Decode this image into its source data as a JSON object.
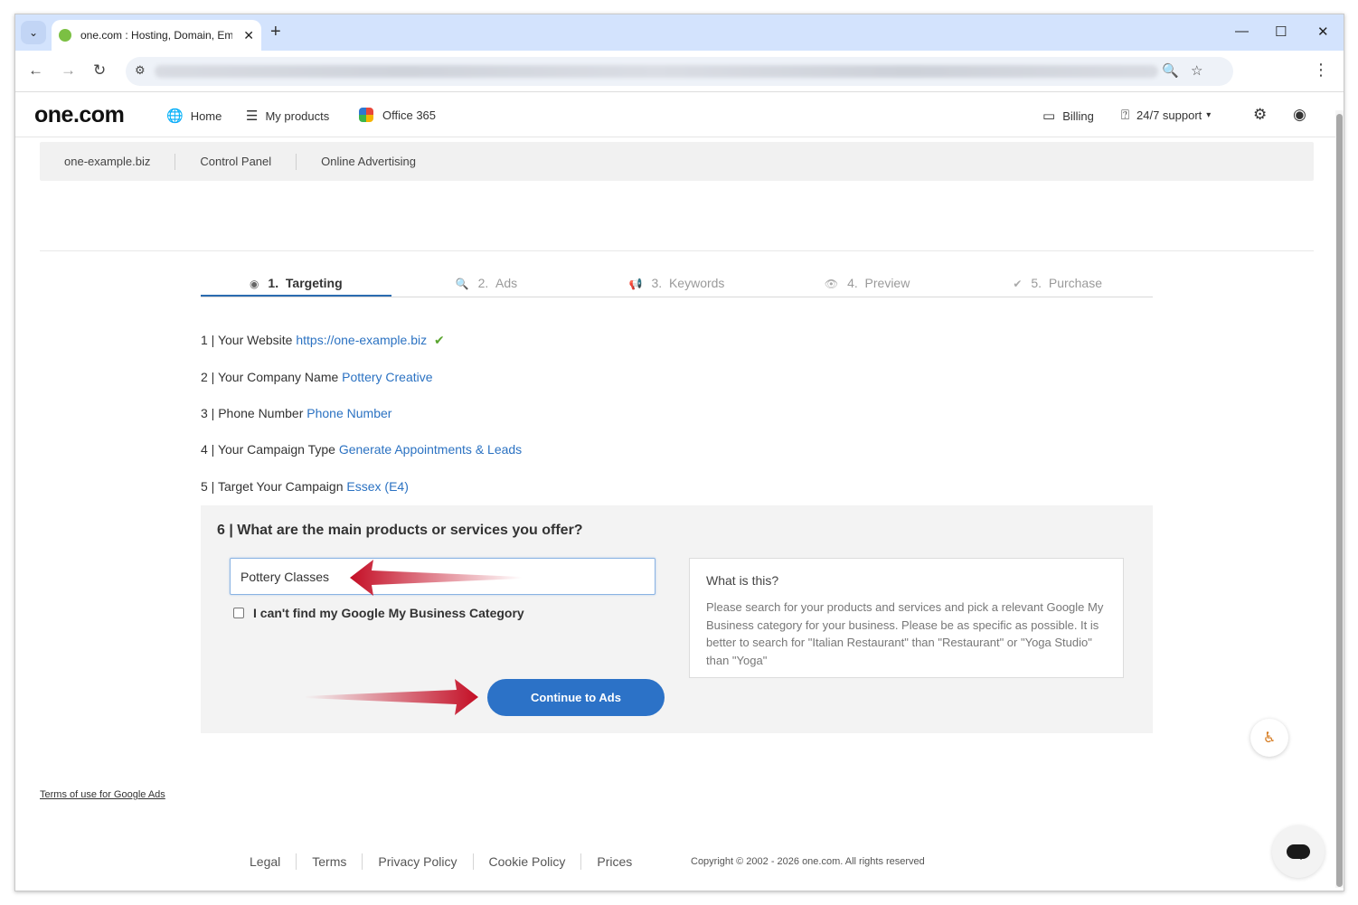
{
  "browser": {
    "tab_title": "one.com : Hosting, Domain, Em",
    "tab_close": "✕",
    "new_tab": "+",
    "tab_menu": "⌄",
    "minimize": "—",
    "maximize": "☐",
    "close": "✕"
  },
  "header": {
    "logo": "one.com",
    "nav": {
      "home": "Home",
      "my_products": "My products",
      "office365": "Office 365",
      "billing": "Billing",
      "support": "24/7 support"
    }
  },
  "breadcrumb": [
    "one-example.biz",
    "Control Panel",
    "Online Advertising"
  ],
  "steps": [
    {
      "number": "1.",
      "label": "Targeting",
      "icon": "◉"
    },
    {
      "number": "2.",
      "label": "Ads",
      "icon": "🔍"
    },
    {
      "number": "3.",
      "label": "Keywords",
      "icon": "📢"
    },
    {
      "number": "4.",
      "label": "Preview",
      "icon": "👁"
    },
    {
      "number": "5.",
      "label": "Purchase",
      "icon": "✔"
    }
  ],
  "rows": {
    "website": {
      "label": "1 | Your Website",
      "value": "https://one-example.biz",
      "check": "✔"
    },
    "company": {
      "label": "2 | Your Company Name",
      "value": "Pottery Creative"
    },
    "phone": {
      "label": "3 | Phone Number",
      "value": "Phone Number"
    },
    "campaign_type": {
      "label": "4 | Your Campaign Type",
      "value": "Generate Appointments & Leads"
    },
    "target": {
      "label": "5 | Target Your Campaign",
      "value": "Essex (E4)"
    }
  },
  "section6": {
    "title": "6 | What are the main products or services you offer?",
    "input_value": "Pottery Classes",
    "checkbox_label": "I can't find my Google My Business Category",
    "continue_label": "Continue to Ads",
    "info_title": "What is this?",
    "info_text": "Please search for your products and services and pick a relevant Google My Business category for your business. Please be as specific as possible. It is better to search for \"Italian Restaurant\" than \"Restaurant\" or \"Yoga Studio\" than \"Yoga\""
  },
  "terms_link": "Terms of use for Google Ads",
  "footer": {
    "links": [
      "Legal",
      "Terms",
      "Privacy Policy",
      "Cookie Policy",
      "Prices"
    ],
    "copyright": "Copyright © 2002 - 2026 one.com. All rights reserved"
  },
  "colors": {
    "accent": "#2c72c7",
    "link": "#2b72c2",
    "check": "#5aa52f",
    "arrow": "#d0112b"
  }
}
